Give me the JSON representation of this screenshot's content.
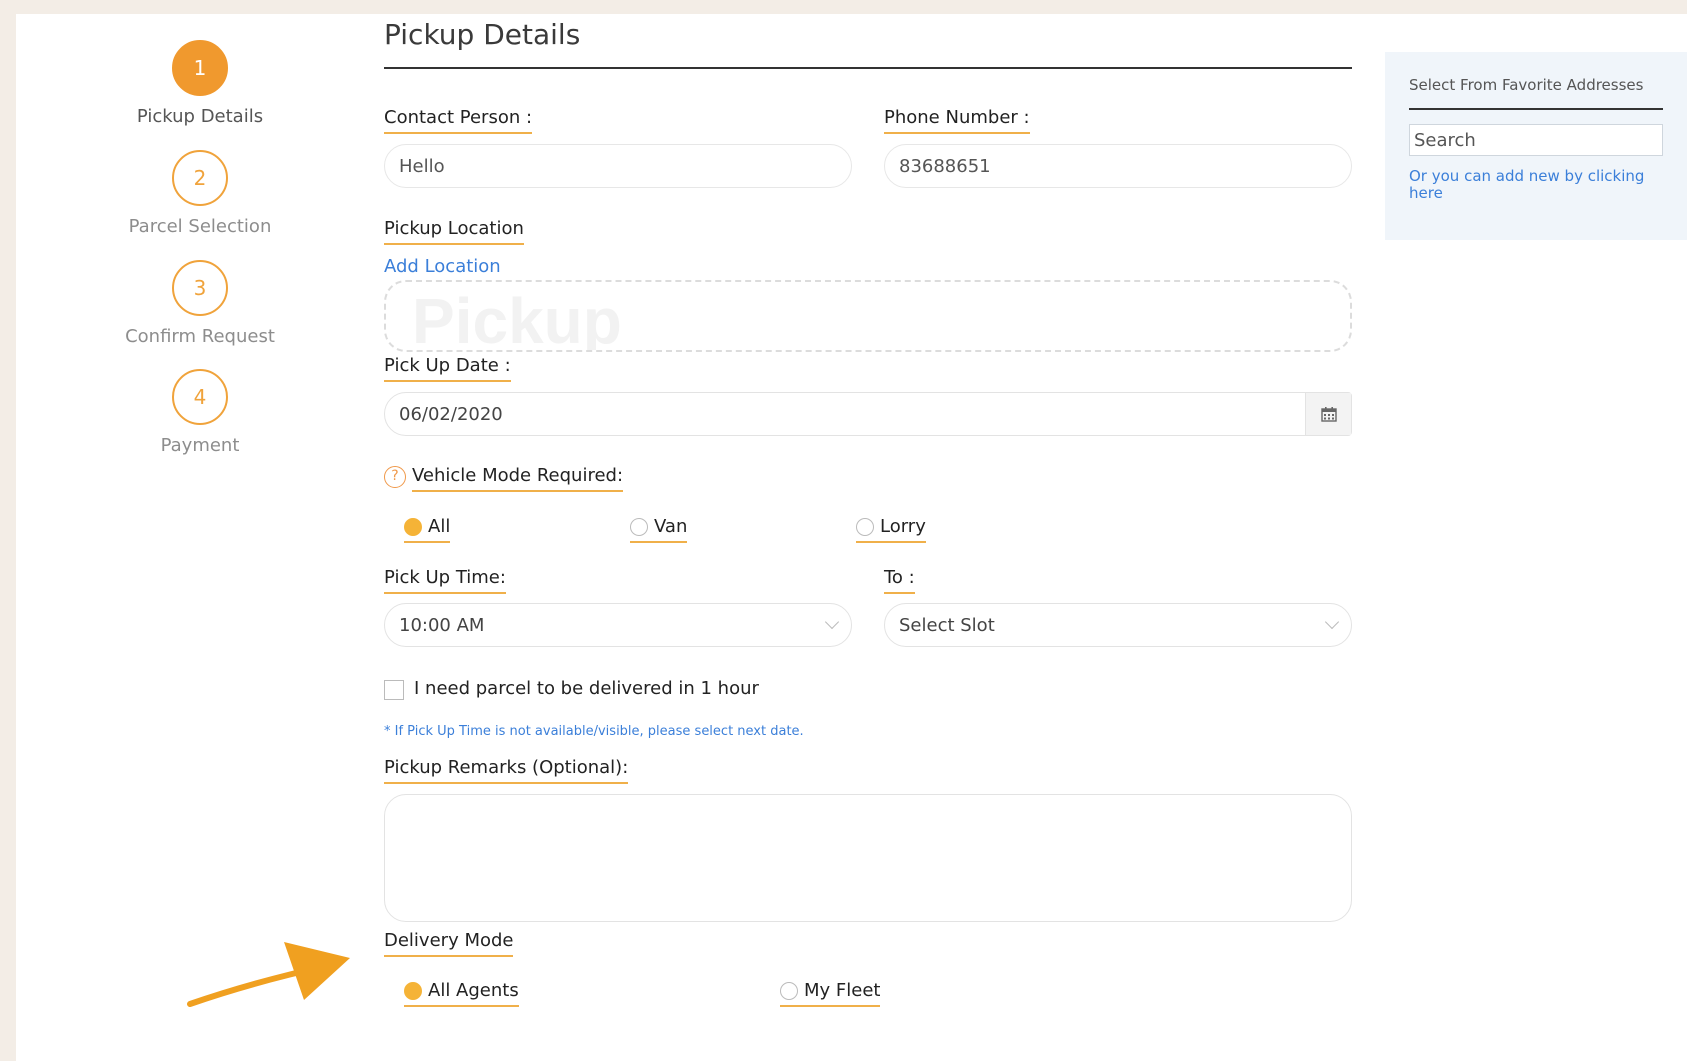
{
  "steps": [
    {
      "number": "1",
      "label": "Pickup Details",
      "active": true
    },
    {
      "number": "2",
      "label": "Parcel Selection",
      "active": false
    },
    {
      "number": "3",
      "label": "Confirm Request",
      "active": false
    },
    {
      "number": "4",
      "label": "Payment",
      "active": false
    }
  ],
  "form": {
    "title": "Pickup Details",
    "contact_label": "Contact Person :",
    "contact_value": "Hello",
    "phone_label": "Phone Number :",
    "phone_value": "83688651",
    "location_label": "Pickup Location",
    "add_location": "Add Location",
    "location_watermark": "Pickup",
    "date_label": "Pick Up Date :",
    "date_value": "06/02/2020",
    "help_icon_char": "?",
    "vehicle_label": "Vehicle Mode Required:",
    "vehicle_options": [
      {
        "label": "All",
        "selected": true
      },
      {
        "label": "Van",
        "selected": false
      },
      {
        "label": "Lorry",
        "selected": false
      }
    ],
    "time_label": "Pick Up Time:",
    "time_value": "10:00 AM",
    "to_label": "To :",
    "to_value": "Select Slot",
    "one_hour_label": "I need parcel to be delivered in 1 hour",
    "one_hour_checked": false,
    "note": "* If Pick Up Time is not available/visible, please select next date.",
    "remarks_label": "Pickup Remarks (Optional):",
    "remarks_value": "",
    "delivery_label": "Delivery Mode",
    "delivery_options": [
      {
        "label": "All Agents",
        "selected": true
      },
      {
        "label": "My Fleet",
        "selected": false
      }
    ]
  },
  "favorites": {
    "title": "Select From Favorite Addresses",
    "search_value": "Search",
    "add_link": "Or you can add new by clicking here"
  },
  "colors": {
    "accent": "#f0992e",
    "link": "#3b7fd9",
    "panel_bg": "#f0f5fa"
  }
}
